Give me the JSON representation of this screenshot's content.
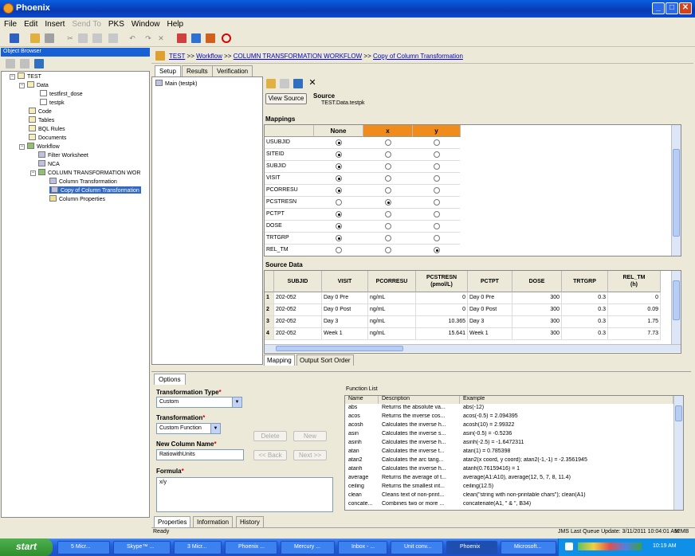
{
  "window": {
    "title": "Phoenix"
  },
  "menu": [
    "File",
    "Edit",
    "Insert",
    "Send To",
    "PKS",
    "Window",
    "Help"
  ],
  "object_browser": {
    "title": "Object Browser",
    "tree": [
      {
        "label": "TEST"
      },
      {
        "label": "Data"
      },
      {
        "label": "testfirst_dose"
      },
      {
        "label": "testpk"
      },
      {
        "label": "Code"
      },
      {
        "label": "Tables"
      },
      {
        "label": "BQL Rules"
      },
      {
        "label": "Documents"
      },
      {
        "label": "Workflow"
      },
      {
        "label": "Filter Worksheet"
      },
      {
        "label": "NCA"
      },
      {
        "label": "COLUMN TRANSFORMATION WOR"
      },
      {
        "label": "Column Transformation"
      },
      {
        "label": "Copy of Column Transformation"
      },
      {
        "label": "Column Properties"
      }
    ]
  },
  "breadcrumb": {
    "test": "TEST",
    "workflow": "Workflow",
    "ctw": "COLUMN TRANSFORMATION WORKFLOW",
    "copy": "Copy of Column Transformation",
    "sep": ">>"
  },
  "top_tabs": [
    "Setup",
    "Results",
    "Verification"
  ],
  "left_item": "Main (testpk)",
  "source": {
    "button": "View Source",
    "label": "Source",
    "value": "TEST.Data.testpk"
  },
  "mappings": {
    "title": "Mappings",
    "columns": [
      "None",
      "x",
      "y"
    ],
    "rows": [
      {
        "name": "USUBJID",
        "sel": 0
      },
      {
        "name": "SITEID",
        "sel": 0
      },
      {
        "name": "SUBJID",
        "sel": 0
      },
      {
        "name": "VISIT",
        "sel": 0
      },
      {
        "name": "PCORRESU",
        "sel": 0
      },
      {
        "name": "PCSTRESN",
        "sel": 1
      },
      {
        "name": "PCTPT",
        "sel": 0
      },
      {
        "name": "DOSE",
        "sel": 0
      },
      {
        "name": "TRTGRP",
        "sel": 0
      },
      {
        "name": "REL_TM",
        "sel": 2
      }
    ]
  },
  "source_data": {
    "title": "Source Data",
    "headers": [
      "SUBJID",
      "VISIT",
      "PCORRESU",
      "PCSTRESN\n(pmol/L)",
      "PCTPT",
      "DOSE",
      "TRTGRP",
      "REL_TM\n(h)"
    ],
    "rows": [
      [
        "1",
        "202-052",
        "Day 0 Pre",
        "ng/mL",
        "0",
        "Day 0 Pre",
        "300",
        "0.3",
        "0"
      ],
      [
        "2",
        "202-052",
        "Day 0 Post",
        "ng/mL",
        "0",
        "Day 0 Post",
        "300",
        "0.3",
        "0.09"
      ],
      [
        "3",
        "202-052",
        "Day 3",
        "ng/mL",
        "10.365",
        "Day 3",
        "300",
        "0.3",
        "1.75"
      ],
      [
        "4",
        "202-052",
        "Week 1",
        "ng/mL",
        "15.641",
        "Week 1",
        "300",
        "0.3",
        "7.73"
      ]
    ]
  },
  "mapping_tabs": [
    "Mapping",
    "Output Sort Order"
  ],
  "options": {
    "tab": "Options",
    "transformation_type_label": "Transformation Type",
    "transformation_type": "Custom",
    "transformation_label": "Transformation",
    "transformation": "Custom Function",
    "new_column_label": "New Column Name",
    "new_column": "RatiowithUnits",
    "formula_label": "Formula",
    "formula": "x/y",
    "delete": "Delete",
    "new": "New",
    "back": "<< Back",
    "next": "Next >>",
    "function_list_title": "Function List",
    "fl_headers": [
      "Name",
      "Description",
      "Example"
    ],
    "functions": [
      [
        "abs",
        "Returns the absolute va...",
        "abs(-12)"
      ],
      [
        "acos",
        "Returns the inverse cos...",
        "acos(-0.5) = 2.094395"
      ],
      [
        "acosh",
        "Calculates the inverse h...",
        "acosh(10) = 2.99322"
      ],
      [
        "asin",
        "Calculates the inverse s...",
        "asin(-0.5) = -0.5236"
      ],
      [
        "asinh",
        "Calculates the inverse h...",
        "asinh(-2.5) = -1.6472311"
      ],
      [
        "atan",
        "Calculates the inverse t...",
        "atan(1) = 0.785398"
      ],
      [
        "atan2",
        "Calculates the arc tang...",
        "atan2(x coord, y coord); atan2(-1,-1) = -2.3561945"
      ],
      [
        "atanh",
        "Calculates the inverse h...",
        "atanh(0.76159416) = 1"
      ],
      [
        "average",
        "Returns the average of t...",
        "average(A1:A10), average(12, 5, 7, 8, 11.4)"
      ],
      [
        "ceiling",
        "Returns the smallest int...",
        "ceiling(12.5)"
      ],
      [
        "clean",
        "Cleans text of non-print...",
        "clean(\"string with non-printable chars\"); clean(A1)"
      ],
      [
        "concate...",
        "Combines two or more ...",
        "concatenate(A1, \" & \", B34)"
      ]
    ]
  },
  "bottom_tabs": [
    "Properties",
    "Information",
    "History"
  ],
  "status": {
    "left": "Ready",
    "right": "JMS Last Queue Update: 3/11/2011 10:04:01 AM",
    "mem": "92MB"
  },
  "taskbar": {
    "start": "start",
    "items": [
      "5 Micr...",
      "Skype™ ...",
      "3 Micr...",
      "Phoenix ...",
      "Mercury ...",
      "Inbox - ...",
      "Unit conv...",
      "Phoenix",
      "Microsoft..."
    ],
    "time": "10:19 AM"
  }
}
